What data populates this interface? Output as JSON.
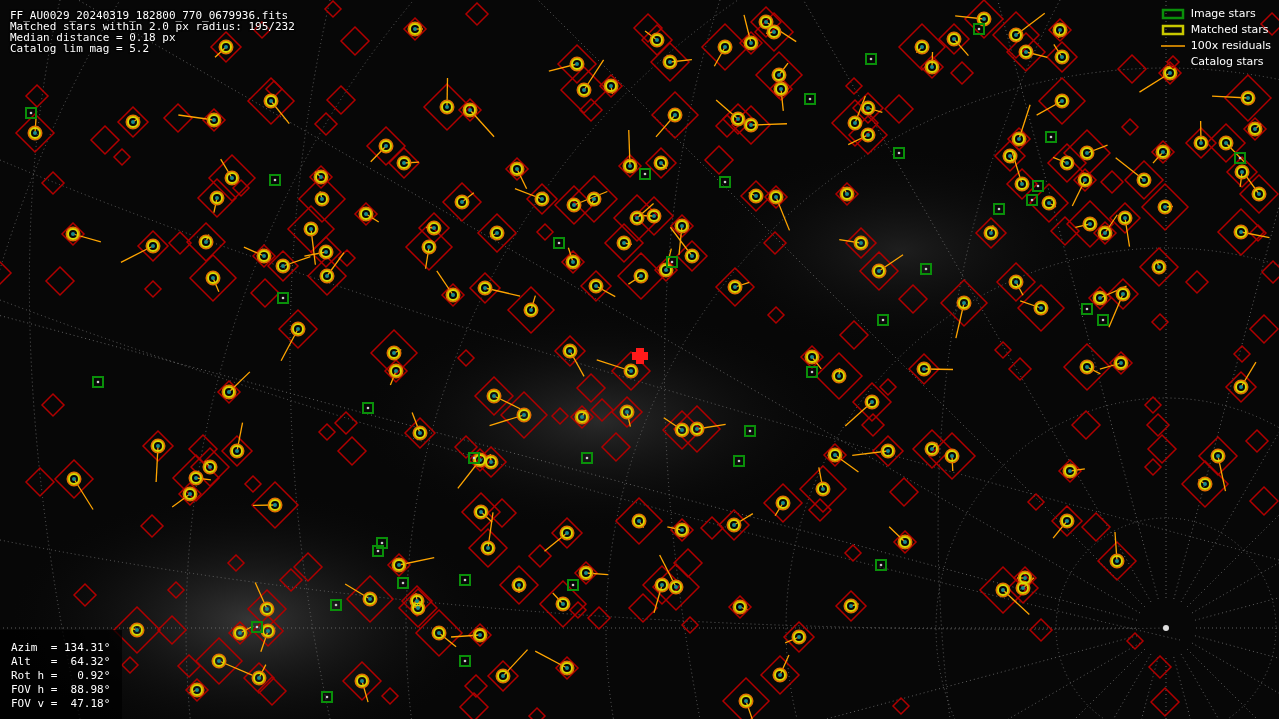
{
  "info": {
    "lines": [
      "FF_AU0029_20240319_182800_770_0679936.fits",
      "Matched stars within 2.0 px radius: 195/232",
      "Median distance = 0.18 px",
      "Catalog lim mag = 5.2"
    ]
  },
  "legend": [
    {
      "kind": "image",
      "label": "Image stars"
    },
    {
      "kind": "matched",
      "label": "Matched stars"
    },
    {
      "kind": "residual",
      "label": "100x residuals"
    },
    {
      "kind": "catalog",
      "label": "Catalog stars"
    }
  ],
  "pointing": {
    "lines": [
      "Azim  = 134.31°",
      "Alt   =  64.32°",
      "Rot h =   0.92°",
      "FOV h =  88.98°",
      "FOV v =  47.18°"
    ]
  }
}
